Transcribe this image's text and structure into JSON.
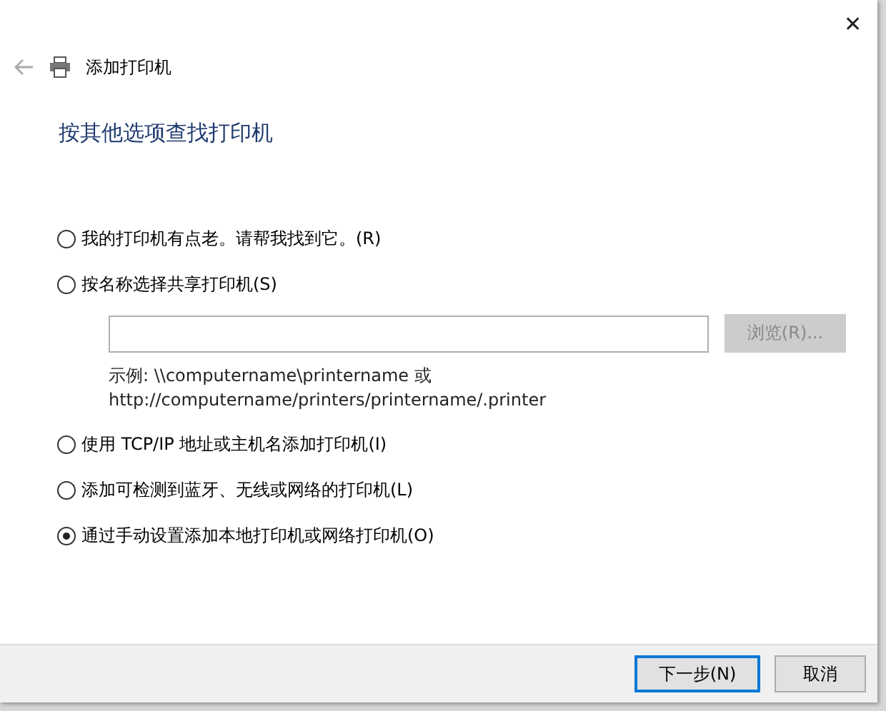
{
  "window": {
    "title": "添加打印机",
    "close": "✕"
  },
  "heading": "按其他选项查找打印机",
  "options": [
    {
      "label": "我的打印机有点老。请帮我找到它。(R)",
      "selected": false
    },
    {
      "label": "按名称选择共享打印机(S)",
      "selected": false,
      "kind": "share"
    },
    {
      "label": "使用 TCP/IP 地址或主机名添加打印机(I)",
      "selected": false
    },
    {
      "label": "添加可检测到蓝牙、无线或网络的打印机(L)",
      "selected": false
    },
    {
      "label": "通过手动设置添加本地打印机或网络打印机(O)",
      "selected": true
    }
  ],
  "share": {
    "browse": {
      "label": "浏览(R)...",
      "disabled": true
    },
    "example_lines": [
      "示例: \\\\computername\\printername 或",
      "http://computername/printers/printername/.printer"
    ]
  },
  "footer": {
    "buttons": [
      {
        "label": "下一步(N)",
        "kind": "default"
      },
      {
        "label": "取消",
        "kind": "normal"
      }
    ]
  }
}
